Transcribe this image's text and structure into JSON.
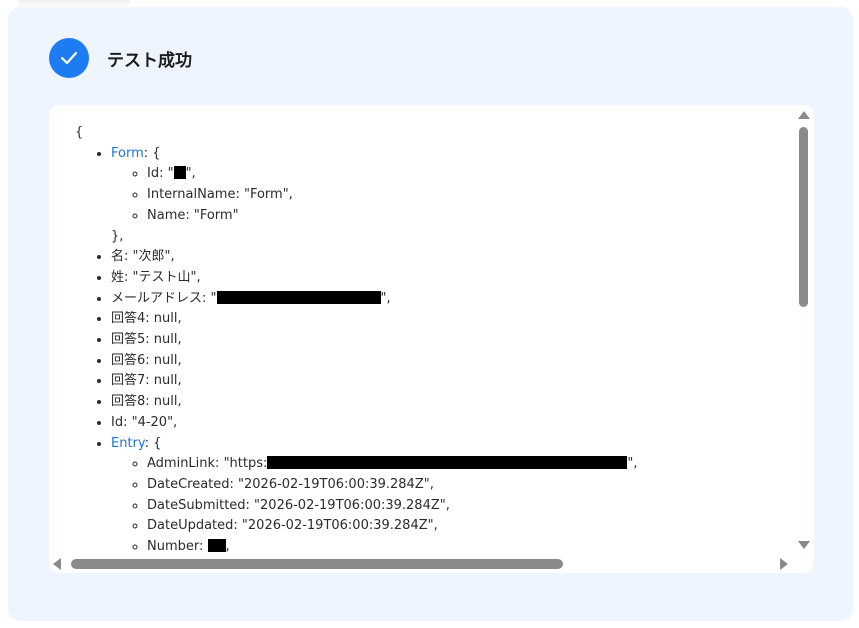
{
  "header": {
    "title": "テスト成功",
    "icon": "check-icon"
  },
  "colors": {
    "accent": "#1e7cf2",
    "panel_bg": "#eef5fe",
    "link": "#1a73d9"
  },
  "json": {
    "open_brace": "{",
    "form": {
      "key": "Form",
      "open": ": {",
      "id_prefix": "Id: \"",
      "id_suffix": "\",",
      "internal_name": "InternalName: \"Form\",",
      "name": "Name: \"Form\"",
      "close": "},"
    },
    "lines": [
      "名: \"次郎\",",
      "姓: \"テスト山\","
    ],
    "email": {
      "prefix": "メールアドレス: \"",
      "suffix": "\","
    },
    "answers": [
      "回答4: null,",
      "回答5: null,",
      "回答6: null,",
      "回答7: null,",
      "回答8: null,",
      "Id: \"4-20\","
    ],
    "entry": {
      "key": "Entry",
      "open": ": {",
      "admin_prefix": "AdminLink: \"https:",
      "admin_suffix": "\",",
      "date_created": "DateCreated: \"2026-02-19T06:00:39.284Z\",",
      "date_submitted": "DateSubmitted: \"2026-02-19T06:00:39.284Z\",",
      "date_updated": "DateUpdated: \"2026-02-19T06:00:39.284Z\",",
      "number_prefix": "Number: ",
      "number_suffix": ","
    }
  }
}
